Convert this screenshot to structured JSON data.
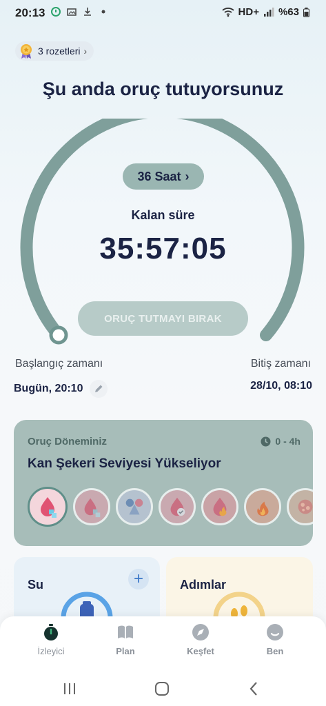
{
  "status_bar": {
    "time": "20:13",
    "network": "HD+",
    "battery": "%63"
  },
  "badges": {
    "label": "3 rozetleri"
  },
  "header": {
    "title": "Şu anda oruç tutuyorsunuz"
  },
  "timer": {
    "plan_label": "36 Saat",
    "remaining_label": "Kalan süre",
    "remaining_time": "35:57:05",
    "stop_button": "ORUÇ TUTMAYI BIRAK",
    "progress": 0.001
  },
  "times": {
    "start_label": "Başlangıç zamanı",
    "start_value": "Bugün, 20:10",
    "end_label": "Bitiş zamanı",
    "end_value": "28/10, 08:10"
  },
  "phase": {
    "subtitle": "Oruç Döneminiz",
    "range": "0 - 4h",
    "title": "Kan Şekeri Seviyesi Yükseliyor",
    "icons": [
      "blood-drop-sugar-icon",
      "blood-drop-cubes-icon",
      "scale-drops-icon",
      "drop-check-icon",
      "drop-flame-icon",
      "flame-icon",
      "cells-icon"
    ]
  },
  "widgets": {
    "water_title": "Su",
    "steps_title": "Adımlar"
  },
  "bottom_nav": {
    "items": [
      {
        "label": "İzleyici",
        "icon": "stopwatch-icon"
      },
      {
        "label": "Plan",
        "icon": "book-icon"
      },
      {
        "label": "Keşfet",
        "icon": "compass-icon"
      },
      {
        "label": "Ben",
        "icon": "profile-icon"
      }
    ]
  },
  "colors": {
    "accent": "#6f9590",
    "gauge_track": "#7f9f9b",
    "phase_card": "#a7bdb9",
    "title": "#1b2344"
  }
}
